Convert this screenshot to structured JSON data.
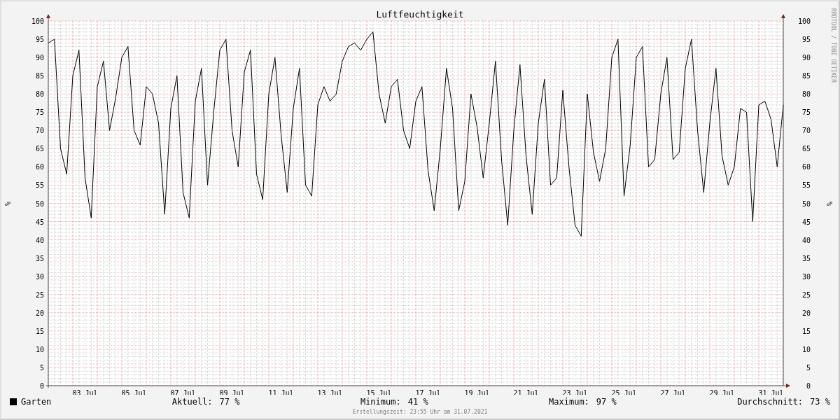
{
  "chart_data": {
    "type": "line",
    "title": "Luftfeuchtigkeit",
    "ylabel": "%",
    "categories": [
      null,
      null,
      null,
      null,
      null,
      null,
      "03 Jul",
      null,
      null,
      null,
      null,
      null,
      null,
      null,
      "05 Jul",
      null,
      null,
      null,
      null,
      null,
      null,
      null,
      "07 Jul",
      null,
      null,
      null,
      null,
      null,
      null,
      null,
      "09 Jul",
      null,
      null,
      null,
      null,
      null,
      null,
      null,
      "11 Jul",
      null,
      null,
      null,
      null,
      null,
      null,
      null,
      "13 Jul",
      null,
      null,
      null,
      null,
      null,
      null,
      null,
      "15 Jul",
      null,
      null,
      null,
      null,
      null,
      null,
      null,
      "17 Jul",
      null,
      null,
      null,
      null,
      null,
      null,
      null,
      "19 Jul",
      null,
      null,
      null,
      null,
      null,
      null,
      null,
      "21 Jul",
      null,
      null,
      null,
      null,
      null,
      null,
      null,
      "23 Jul",
      null,
      null,
      null,
      null,
      null,
      null,
      null,
      "25 Jul",
      null,
      null,
      null,
      null,
      null,
      null,
      null,
      "27 Jul",
      null,
      null,
      null,
      null,
      null,
      null,
      null,
      "29 Jul",
      null,
      null,
      null,
      null,
      null,
      null,
      null,
      "31 Jul",
      null,
      null
    ],
    "series": [
      {
        "name": "Garten",
        "color": "#000000",
        "values": [
          94,
          95,
          65,
          58,
          85,
          92,
          57,
          46,
          82,
          89,
          70,
          79,
          90,
          93,
          70,
          66,
          82,
          80,
          72,
          47,
          76,
          85,
          53,
          46,
          78,
          87,
          55,
          75,
          92,
          95,
          70,
          60,
          86,
          92,
          58,
          51,
          80,
          90,
          69,
          53,
          76,
          87,
          55,
          52,
          77,
          82,
          78,
          80,
          89,
          93,
          94,
          92,
          95,
          97,
          80,
          72,
          82,
          84,
          70,
          65,
          78,
          82,
          59,
          48,
          65,
          87,
          76,
          48,
          56,
          80,
          71,
          57,
          72,
          89,
          62,
          44,
          70,
          88,
          63,
          47,
          72,
          84,
          55,
          57,
          81,
          60,
          44,
          41,
          80,
          64,
          56,
          65,
          90,
          95,
          52,
          66,
          90,
          93,
          60,
          62,
          80,
          90,
          62,
          64,
          87,
          95,
          70,
          53,
          72,
          87,
          63,
          55,
          60,
          76,
          75,
          45,
          77,
          78,
          73,
          60,
          77
        ]
      }
    ],
    "grid": true,
    "ylim": [
      0,
      100
    ],
    "yticks": [
      0,
      5,
      10,
      15,
      20,
      25,
      30,
      35,
      40,
      45,
      50,
      55,
      60,
      65,
      70,
      75,
      80,
      85,
      90,
      95,
      100
    ]
  },
  "right_axis": {
    "label": "%",
    "ticks": [
      "100",
      "95",
      "90",
      "85",
      "80",
      "75",
      "70",
      "65",
      "60",
      "55",
      "50",
      "45",
      "40",
      "35",
      "30",
      "25",
      "20",
      "15",
      "10",
      "5",
      "0"
    ]
  },
  "credit": "RRDTOOL / TOBI OETIKER",
  "stats": [
    {
      "label": "Aktuell:",
      "value": "77 %"
    },
    {
      "label": "Minimum:",
      "value": "41 %"
    },
    {
      "label": "Maximum:",
      "value": "97 %"
    },
    {
      "label": "Durchschnitt:",
      "value": "73 %"
    }
  ],
  "footer": "Erstellungszeit: 23:55 Uhr am 31.07.2021"
}
